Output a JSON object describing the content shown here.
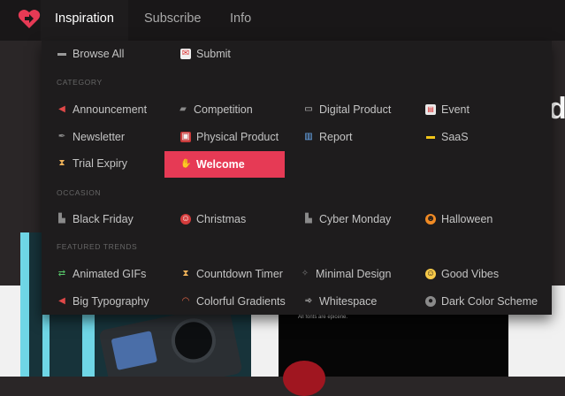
{
  "nav": {
    "items": [
      {
        "label": "Inspiration"
      },
      {
        "label": "Subscribe"
      },
      {
        "label": "Info"
      }
    ]
  },
  "menu": {
    "top": [
      {
        "label": "Browse All",
        "icon": "folder-icon"
      },
      {
        "label": "Submit",
        "icon": "mail-icon"
      }
    ],
    "category_heading": "CATEGORY",
    "category": [
      {
        "label": "Announcement",
        "icon": "megaphone-icon"
      },
      {
        "label": "Competition",
        "icon": "ticket-icon"
      },
      {
        "label": "Digital Product",
        "icon": "laptop-icon"
      },
      {
        "label": "Event",
        "icon": "calendar-icon"
      },
      {
        "label": "Newsletter",
        "icon": "quill-icon"
      },
      {
        "label": "Physical Product",
        "icon": "gift-icon"
      },
      {
        "label": "Report",
        "icon": "bar-chart-icon"
      },
      {
        "label": "SaaS",
        "icon": "credit-card-icon"
      },
      {
        "label": "Trial Expiry",
        "icon": "hourglass-icon"
      },
      {
        "label": "Welcome",
        "icon": "waving-hand-icon"
      }
    ],
    "occasion_heading": "OCCASION",
    "occasion": [
      {
        "label": "Black Friday",
        "icon": "factory-icon"
      },
      {
        "label": "Christmas",
        "icon": "santa-icon"
      },
      {
        "label": "Cyber Monday",
        "icon": "factory-icon"
      },
      {
        "label": "Halloween",
        "icon": "pumpkin-icon"
      }
    ],
    "trends_heading": "FEATURED TRENDS",
    "trends": [
      {
        "label": "Animated GIFs",
        "icon": "recycle-arrows-icon"
      },
      {
        "label": "Countdown Timer",
        "icon": "hourglass-icon"
      },
      {
        "label": "Minimal Design",
        "icon": "sparkle-icon"
      },
      {
        "label": "Good Vibes",
        "icon": "smiley-icon"
      },
      {
        "label": "Big Typography",
        "icon": "megaphone-icon"
      },
      {
        "label": "Colorful Gradients",
        "icon": "rainbow-icon"
      },
      {
        "label": "Whitespace",
        "icon": "wind-icon"
      },
      {
        "label": "Dark Color Scheme",
        "icon": "dark-ball-icon"
      }
    ],
    "active_item": "Welcome"
  },
  "background": {
    "card_text": "All fonts are epicene."
  },
  "colors": {
    "accent": "#e63a55",
    "menu_bg": "#1e1c1d",
    "topbar_bg": "#191718"
  }
}
